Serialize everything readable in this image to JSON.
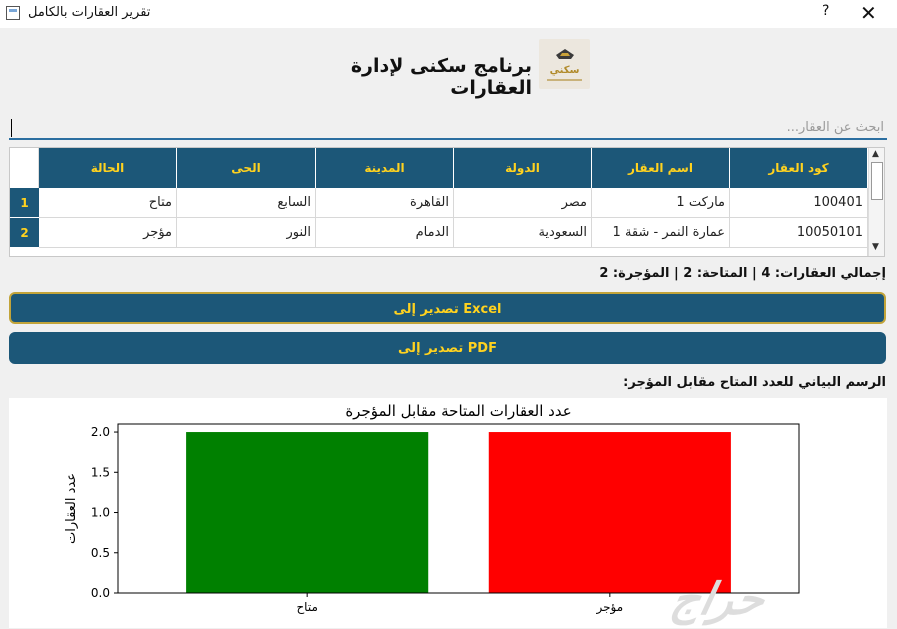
{
  "window": {
    "title": "تقرير العقارات بالكامل",
    "help": "?",
    "close": "✕"
  },
  "header": {
    "title": "برنامج سكنى لإدارة العقارات",
    "logo_text": "سكني"
  },
  "search": {
    "placeholder": "ابحث عن العقار...",
    "value": ""
  },
  "table": {
    "columns": [
      "كود العقار",
      "اسم العقار",
      "الدولة",
      "المدينة",
      "الحى",
      "الحالة"
    ],
    "rows": [
      {
        "num": "1",
        "cells": [
          "100401",
          "ماركت 1",
          "مصر",
          "القاهرة",
          "السابع",
          "متاح"
        ]
      },
      {
        "num": "2",
        "cells": [
          "10050101",
          "عمارة النمر - شقة 1",
          "السعودية",
          "الدمام",
          "النور",
          "مؤجر"
        ]
      }
    ]
  },
  "totals": "إجمالي العقارات: 4 | المتاحة: 2 | المؤجرة: 2",
  "buttons": {
    "excel": "Excel تصدير إلى",
    "pdf": "PDF تصدير إلى"
  },
  "chart_label": "الرسم البياني للعدد المتاح مقابل المؤجر:",
  "watermark": "حراج",
  "colors": {
    "accent": "#1c5778",
    "accent_text": "#ffd21f",
    "bar_available": "#008000",
    "bar_rented": "#ff0000"
  },
  "chart_data": {
    "type": "bar",
    "title": "عدد العقارات المتاحة مقابل المؤجرة",
    "categories": [
      "متاح",
      "مؤجر"
    ],
    "values": [
      2,
      2
    ],
    "colors": [
      "#008000",
      "#ff0000"
    ],
    "ylabel": "عدد العقارات",
    "xlabel": "",
    "ylim": [
      0,
      2.1
    ],
    "yticks": [
      "0.0",
      "0.5",
      "1.0",
      "1.5",
      "2.0"
    ],
    "grid": false
  }
}
